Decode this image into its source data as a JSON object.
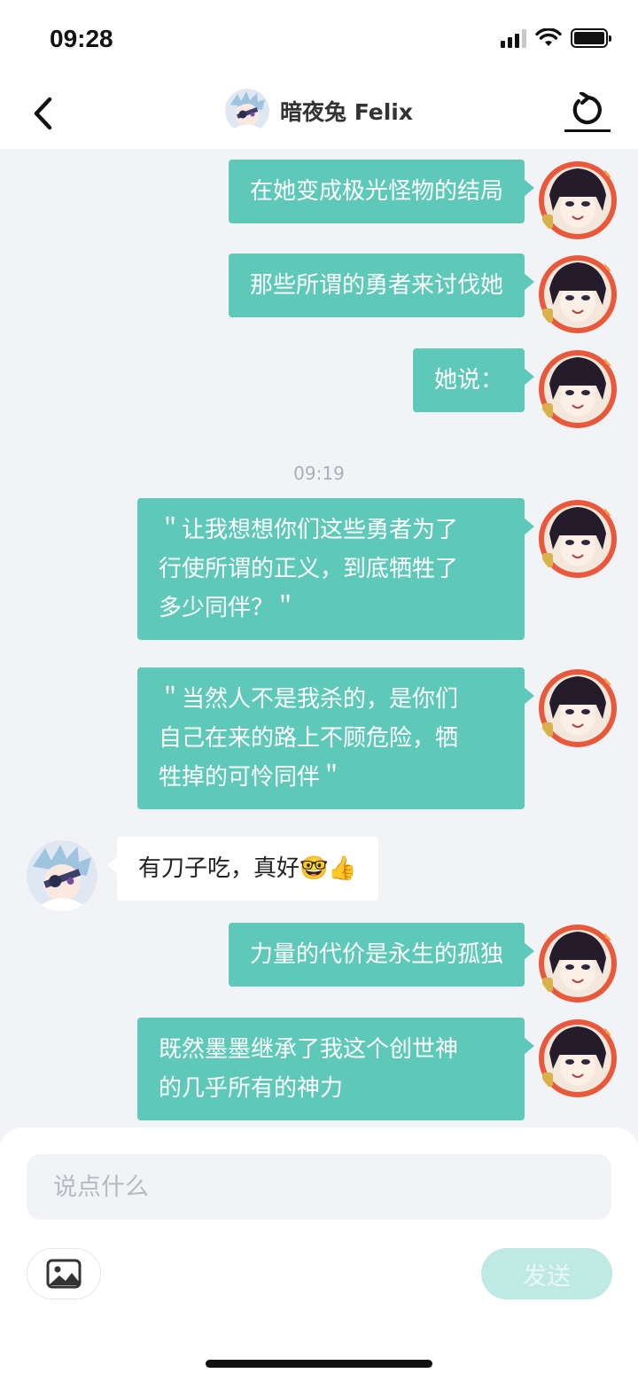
{
  "status": {
    "time": "09:28"
  },
  "header": {
    "title": "暗夜兔 Felix"
  },
  "messages": [
    {
      "from": "me",
      "lines": [
        "在她变成极光怪物的结局"
      ]
    },
    {
      "from": "me",
      "lines": [
        "那些所谓的勇者来讨伐她"
      ]
    },
    {
      "from": "me",
      "lines": [
        "她说："
      ]
    },
    {
      "type": "timestamp",
      "text": "09:19"
    },
    {
      "from": "me",
      "lines": [
        "＂让我想想你们这些勇者为了",
        "行使所谓的正义，到底牺牲了",
        "多少同伴？＂"
      ]
    },
    {
      "from": "me",
      "lines": [
        "＂当然人不是我杀的，是你们",
        "自己在来的路上不顾危险，牺",
        "牲掉的可怜同伴＂"
      ]
    },
    {
      "from": "other",
      "lines": [
        "有刀子吃，真好🤓👍"
      ]
    },
    {
      "from": "me",
      "lines": [
        "力量的代价是永生的孤独"
      ]
    },
    {
      "from": "me",
      "lines": [
        "既然墨墨继承了我这个创世神",
        "的几乎所有的神力"
      ]
    }
  ],
  "input": {
    "placeholder": "说点什么",
    "value": ""
  },
  "send_label": "发送",
  "colors": {
    "bubble_out": "#5ec9b9",
    "send_disabled": "#bfeae3",
    "background": "#f2f3f6"
  },
  "icons": {
    "back": "chevron-left-icon",
    "refresh": "refresh-icon",
    "image": "image-icon"
  }
}
